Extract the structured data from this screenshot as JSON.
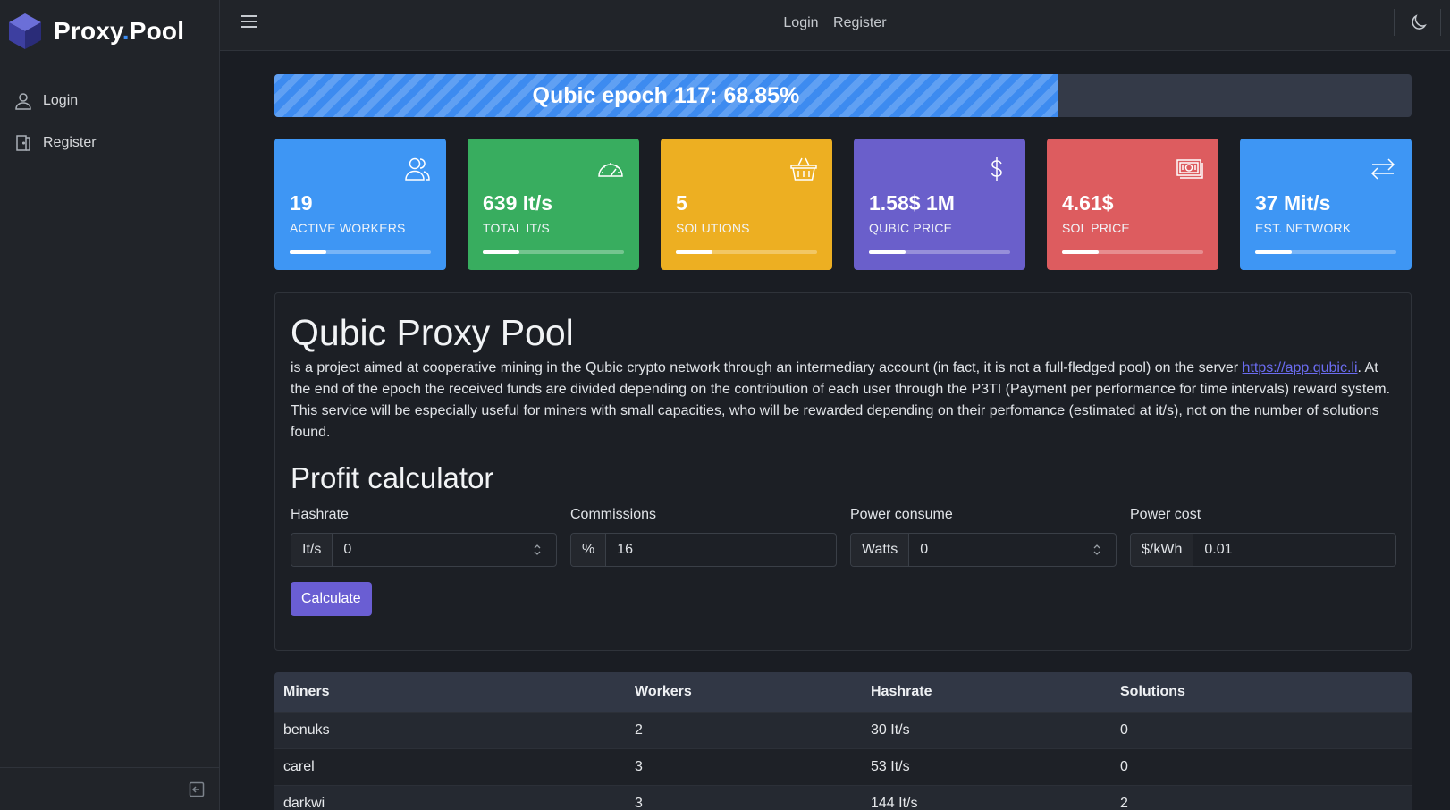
{
  "brand": {
    "name_part1": "Proxy",
    "dot": ".",
    "name_part2": "Pool"
  },
  "sidebar": {
    "items": [
      {
        "label": "Login",
        "icon": "user-icon"
      },
      {
        "label": "Register",
        "icon": "door-icon"
      }
    ]
  },
  "topbar": {
    "login": "Login",
    "register": "Register"
  },
  "progress": {
    "text": "Qubic epoch 117: 68.85%",
    "percent": 68.85,
    "color": "#3d8bf0"
  },
  "cards": [
    {
      "value": "19",
      "label": "ACTIVE WORKERS",
      "color": "#3e96f4",
      "icon": "users-icon",
      "bar": 0.26
    },
    {
      "value": "639 It/s",
      "label": "TOTAL IT/S",
      "color": "#38ad5f",
      "icon": "speedometer-icon",
      "bar": 0.26
    },
    {
      "value": "5",
      "label": "SOLUTIONS",
      "color": "#edaf22",
      "icon": "basket-icon",
      "bar": 0.26
    },
    {
      "value": "1.58$ 1M",
      "label": "QUBIC PRICE",
      "color": "#6a5fcb",
      "icon": "dollar-icon",
      "bar": 0.26
    },
    {
      "value": "4.61$",
      "label": "SOL PRICE",
      "color": "#dd5c5f",
      "icon": "cash-icon",
      "bar": 0.26
    },
    {
      "value": "37 Mit/s",
      "label": "EST. NETWORK",
      "color": "#3e96f4",
      "icon": "arrows-icon",
      "bar": 0.26
    }
  ],
  "info": {
    "title": "Qubic Proxy Pool",
    "text_before_link": "is a project aimed at cooperative mining in the Qubic crypto network through an intermediary account (in fact, it is not a full-fledged pool) on the server ",
    "link": "https://app.qubic.li",
    "text_after_link": ". At the end of the epoch the received funds are divided depending on the contribution of each user through the P3TI (Payment per performance for time intervals) reward system. This service will be especially useful for miners with small capacities, who will be rewarded depending on their perfomance (estimated at it/s), not on the number of solutions found."
  },
  "calculator": {
    "title": "Profit calculator",
    "fields": [
      {
        "label": "Hashrate",
        "addon": "It/s",
        "value": "0",
        "spinner": true
      },
      {
        "label": "Commissions",
        "addon": "%",
        "value": "16",
        "spinner": false
      },
      {
        "label": "Power consume",
        "addon": "Watts",
        "value": "0",
        "spinner": true
      },
      {
        "label": "Power cost",
        "addon": "$/kWh",
        "value": "0.01",
        "spinner": false
      }
    ],
    "button": "Calculate"
  },
  "table": {
    "headers": [
      "Miners",
      "Workers",
      "Hashrate",
      "Solutions"
    ],
    "rows": [
      [
        "benuks",
        "2",
        "30 It/s",
        "0"
      ],
      [
        "carel",
        "3",
        "53 It/s",
        "0"
      ],
      [
        "darkwi",
        "3",
        "144 It/s",
        "2"
      ]
    ]
  }
}
